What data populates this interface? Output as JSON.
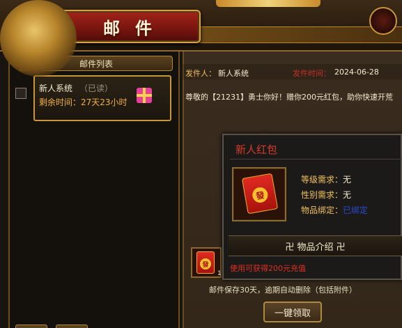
{
  "header": {
    "title": "邮件"
  },
  "list": {
    "title": "邮件列表",
    "items": [
      {
        "sender": "新人系统",
        "status": "（已读）",
        "remaining": "剩余时间：27天23小时"
      }
    ]
  },
  "detail": {
    "sender_label": "发件人：",
    "sender_value": "新人系统",
    "time_label": "发件时间：",
    "time_value": "2024-06-28",
    "body": "尊敬的【21231】勇士你好！赠你200元红包，助你快速开荒"
  },
  "tooltip": {
    "title": "新人红包",
    "item_glyph": "發",
    "level_label": "等级需求：",
    "level_value": "无",
    "gender_label": "性别需求：",
    "gender_value": "无",
    "bind_label": "物品绑定：",
    "bind_value": "已绑定",
    "section_title": "卍 物品介绍 卍",
    "description": "使用可获得200元充值"
  },
  "attachment": {
    "glyph": "發",
    "count": "1"
  },
  "footer": {
    "save_note": "邮件保存30天，逾期自动删除（包括附件）",
    "claim_button": "一键领取"
  }
}
